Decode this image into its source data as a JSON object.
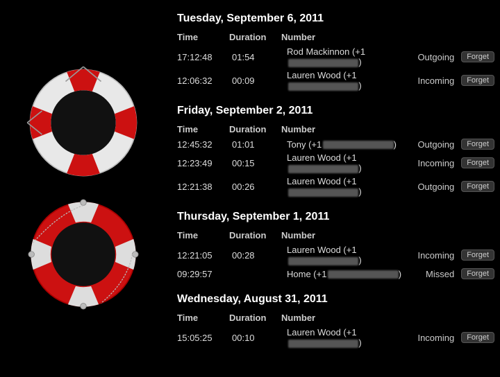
{
  "leftPanel": {
    "buoy1": "lifebuoy-white",
    "buoy2": "lifebuoy-red"
  },
  "groups": [
    {
      "date": "Tuesday, September 6, 2011",
      "headers": {
        "time": "Time",
        "duration": "Duration",
        "number": "Number"
      },
      "calls": [
        {
          "time": "17:12:48",
          "duration": "01:54",
          "name": "Rod Mackinnon (+1",
          "type": "Outgoing",
          "typeClass": "outgoing",
          "forget": "Forget"
        },
        {
          "time": "12:06:32",
          "duration": "00:09",
          "name": "Lauren Wood (+1",
          "type": "Incoming",
          "typeClass": "incoming",
          "forget": "Forget"
        }
      ]
    },
    {
      "date": "Friday, September 2, 2011",
      "headers": {
        "time": "Time",
        "duration": "Duration",
        "number": "Number"
      },
      "calls": [
        {
          "time": "12:45:32",
          "duration": "01:01",
          "name": "Tony (+1",
          "type": "Outgoing",
          "typeClass": "outgoing",
          "forget": "Forget"
        },
        {
          "time": "12:23:49",
          "duration": "00:15",
          "name": "Lauren Wood (+1",
          "type": "Incoming",
          "typeClass": "incoming",
          "forget": "Forget"
        },
        {
          "time": "12:21:38",
          "duration": "00:26",
          "name": "Lauren Wood (+1",
          "type": "Outgoing",
          "typeClass": "outgoing",
          "forget": "Forget"
        }
      ]
    },
    {
      "date": "Thursday, September 1, 2011",
      "headers": {
        "time": "Time",
        "duration": "Duration",
        "number": "Number"
      },
      "calls": [
        {
          "time": "12:21:05",
          "duration": "00:28",
          "name": "Lauren Wood (+1",
          "type": "Incoming",
          "typeClass": "incoming",
          "forget": "Forget"
        },
        {
          "time": "09:29:57",
          "duration": "",
          "name": "Home (+1",
          "type": "Missed",
          "typeClass": "missed",
          "forget": "Forget"
        }
      ]
    },
    {
      "date": "Wednesday, August 31, 2011",
      "headers": {
        "time": "Time",
        "duration": "Duration",
        "number": "Number"
      },
      "calls": [
        {
          "time": "15:05:25",
          "duration": "00:10",
          "name": "Lauren Wood (+1",
          "type": "Incoming",
          "typeClass": "incoming",
          "forget": "Forget"
        }
      ]
    }
  ],
  "buttons": {
    "forget": "Forget"
  }
}
